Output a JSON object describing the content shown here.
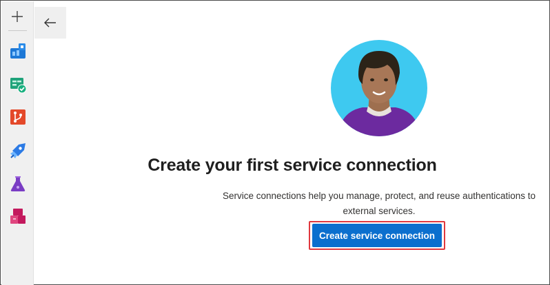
{
  "sidebar": {
    "add_icon": "plus-icon",
    "items": [
      {
        "icon": "boards-icon",
        "name": "Boards"
      },
      {
        "icon": "test-plans-check-icon",
        "name": "Test Plans"
      },
      {
        "icon": "repos-icon",
        "name": "Repos"
      },
      {
        "icon": "pipelines-icon",
        "name": "Pipelines"
      },
      {
        "icon": "test-flask-icon",
        "name": "Test"
      },
      {
        "icon": "artifacts-icon",
        "name": "Artifacts"
      }
    ]
  },
  "header": {
    "back_icon": "back-arrow-icon"
  },
  "empty_state": {
    "title": "Create your first service connection",
    "description_line1": "Service connections help you manage, protect, and reuse authentications to",
    "description_line2": "external services.",
    "button_label": "Create service connection"
  },
  "colors": {
    "accent": "#0b6fce",
    "highlight_outline": "#e0383e",
    "avatar_background": "#3ec9f0"
  }
}
